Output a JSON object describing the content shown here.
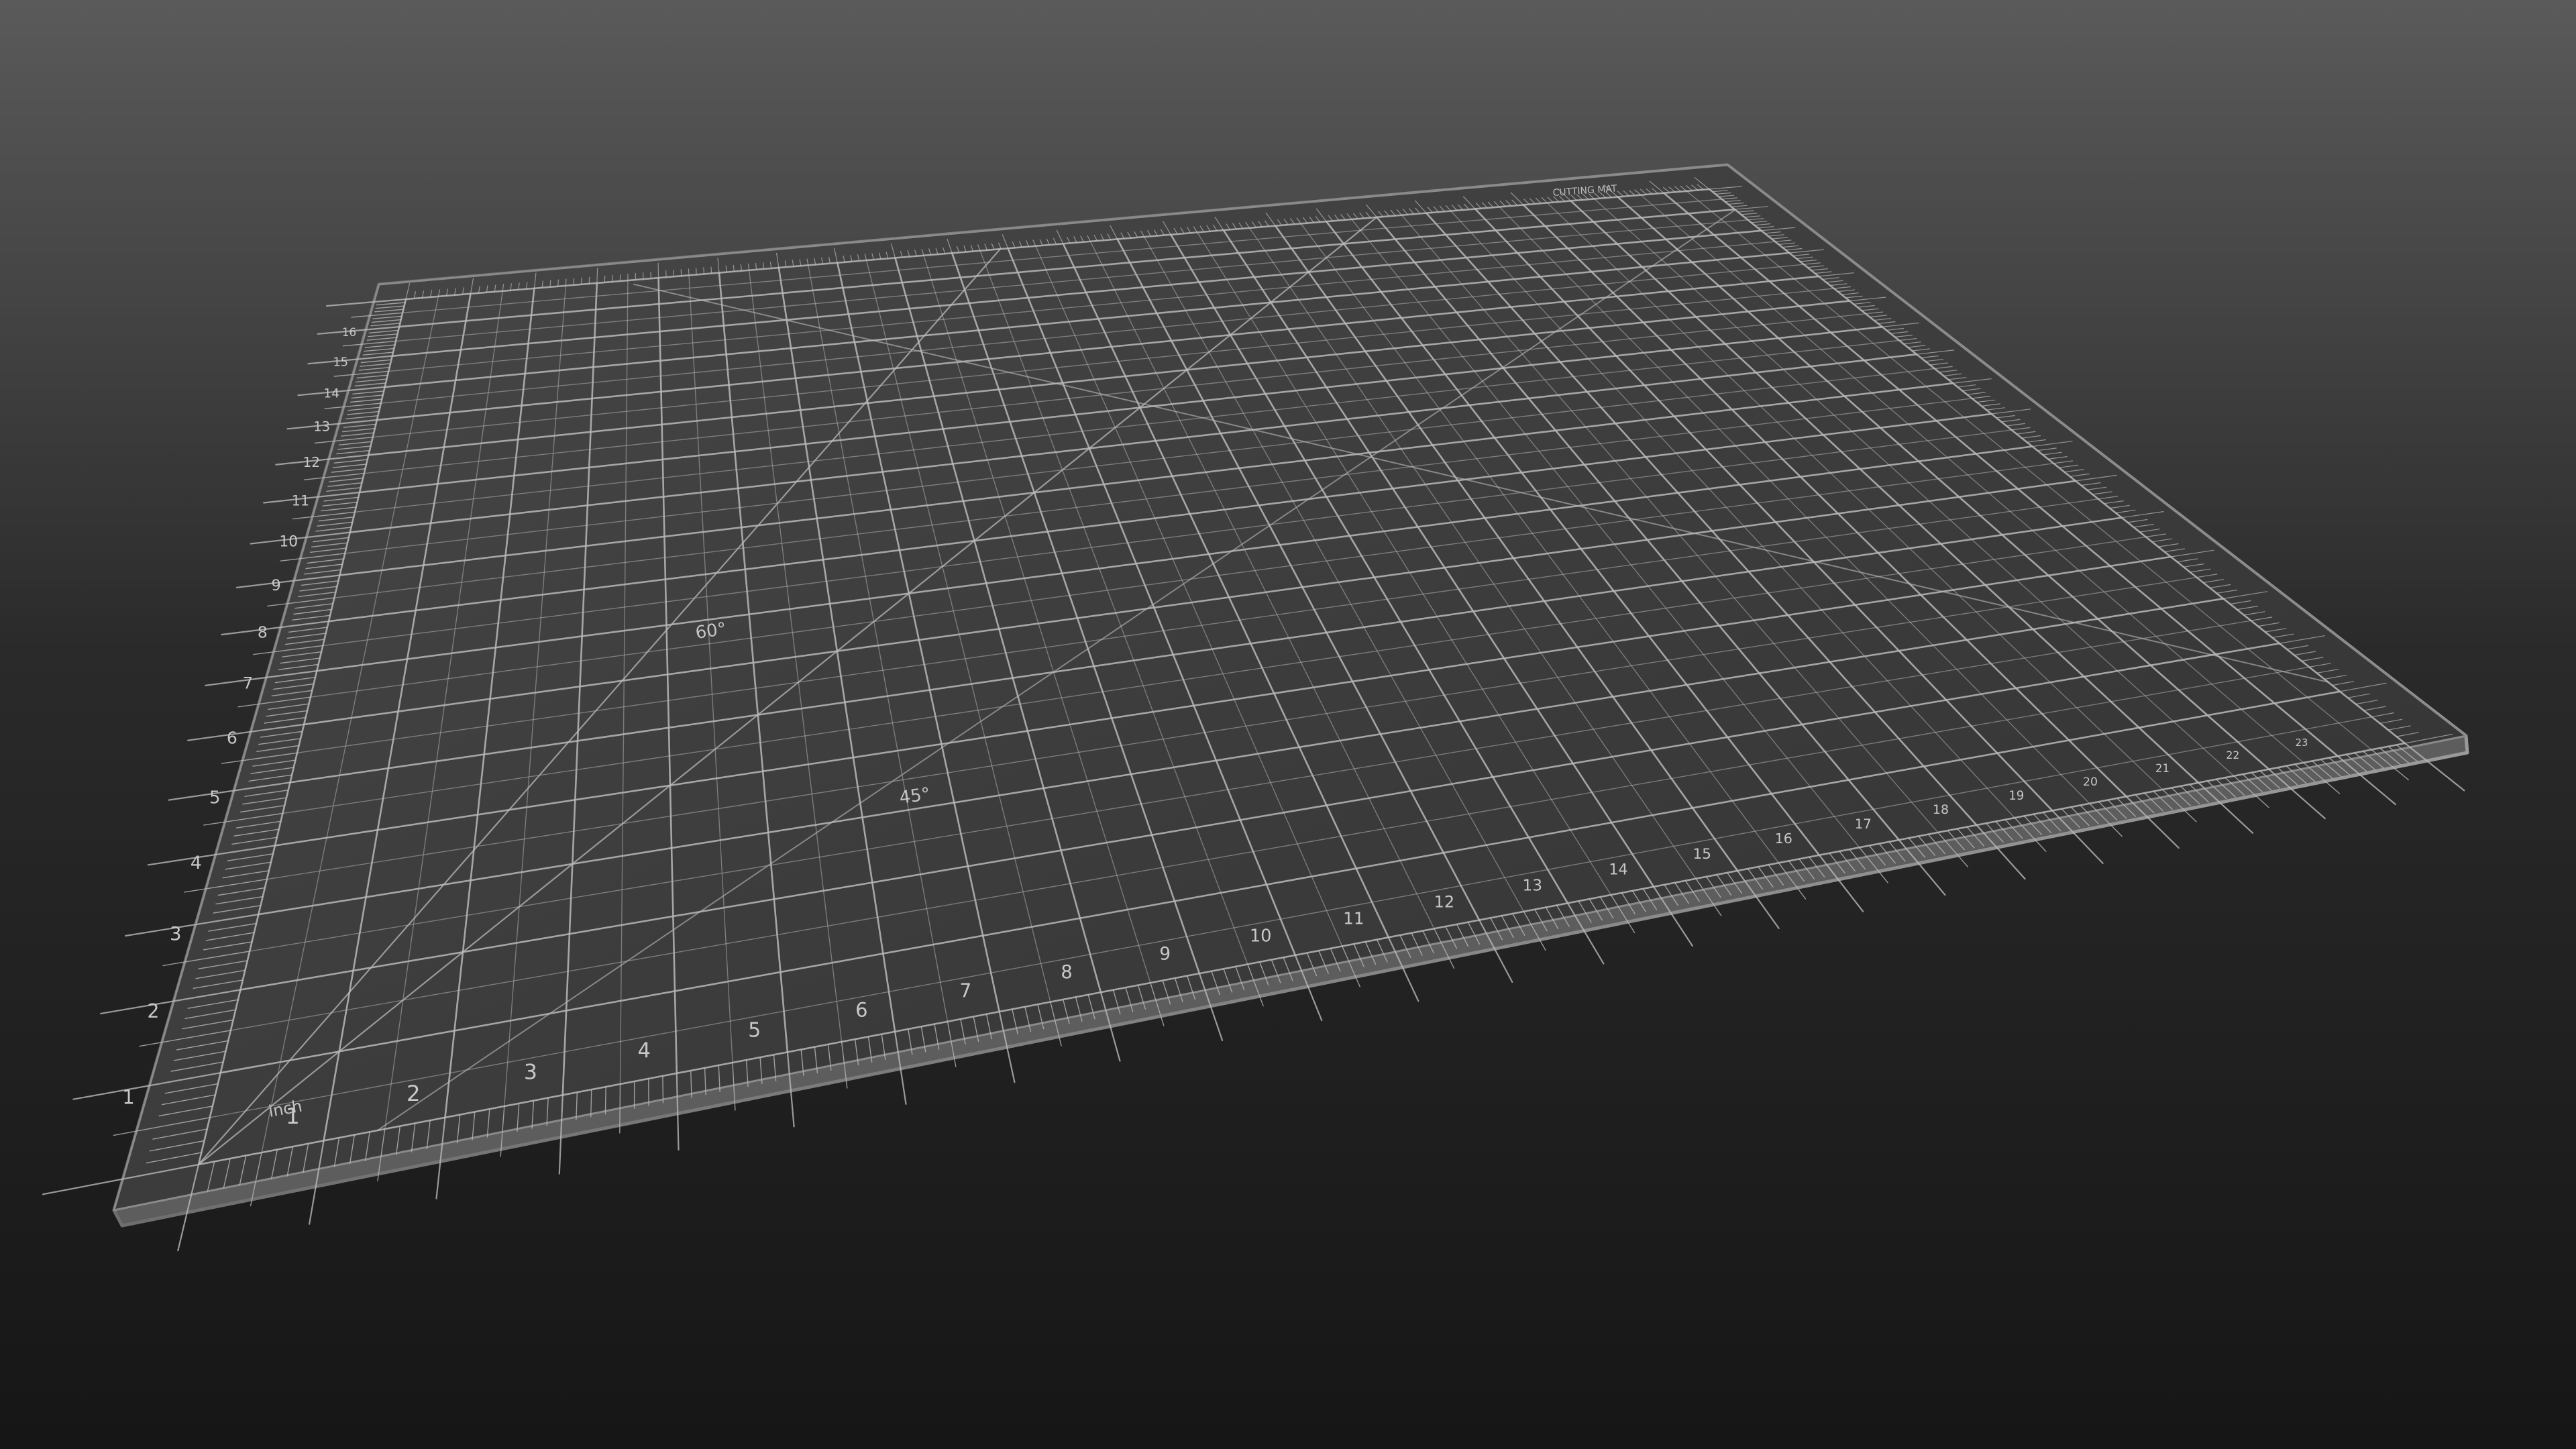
{
  "scene": {
    "background_top": "#5a5a5a",
    "background_bottom": "#161616",
    "subject": "cutting mat"
  },
  "mat": {
    "surface_color": "#3c3c3c",
    "line_color": "#b9b9b9",
    "edge_color": "#8a8a8a",
    "bottom_inch_numbers": [
      "1",
      "2",
      "3",
      "4",
      "5",
      "6",
      "7",
      "8",
      "9",
      "10",
      "11",
      "12",
      "13",
      "14",
      "15",
      "16",
      "17",
      "18",
      "19",
      "20",
      "21",
      "22",
      "23"
    ],
    "left_inch_numbers": [
      "1",
      "2",
      "3",
      "4",
      "5",
      "6",
      "7",
      "8",
      "9",
      "10",
      "11",
      "12",
      "13",
      "14",
      "15",
      "16"
    ],
    "unit_label": "inch",
    "angle_labels": [
      "60°",
      "45°"
    ],
    "corner_title": "CUTTING MAT"
  }
}
